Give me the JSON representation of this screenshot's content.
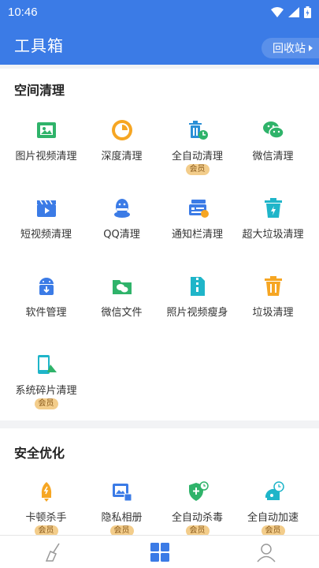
{
  "status": {
    "time": "10:46"
  },
  "app_bar": {
    "title": "工具箱",
    "recycle_label": "回收站"
  },
  "section_space": {
    "title": "空间清理",
    "items": [
      {
        "label": "图片视频清理",
        "icon": "picture-icon"
      },
      {
        "label": "深度清理",
        "icon": "pie-icon"
      },
      {
        "label": "全自动清理",
        "icon": "auto-trash-icon",
        "badge": "会员"
      },
      {
        "label": "微信清理",
        "icon": "wechat-icon"
      },
      {
        "label": "短视频清理",
        "icon": "clapper-icon"
      },
      {
        "label": "QQ清理",
        "icon": "qq-icon"
      },
      {
        "label": "通知栏清理",
        "icon": "notification-icon"
      },
      {
        "label": "超大垃圾清理",
        "icon": "big-trash-icon"
      },
      {
        "label": "软件管理",
        "icon": "android-icon"
      },
      {
        "label": "微信文件",
        "icon": "wechat-folder-icon"
      },
      {
        "label": "照片视频瘦身",
        "icon": "zip-icon"
      },
      {
        "label": "垃圾清理",
        "icon": "trash-icon"
      },
      {
        "label": "系统碎片清理",
        "icon": "phone-broom-icon",
        "badge": "会员"
      }
    ]
  },
  "section_security": {
    "title": "安全优化",
    "items": [
      {
        "label": "卡顿杀手",
        "icon": "rocket-icon",
        "badge": "会员"
      },
      {
        "label": "隐私相册",
        "icon": "private-album-icon",
        "badge": "会员"
      },
      {
        "label": "全自动杀毒",
        "icon": "shield-clock-icon",
        "badge": "会员"
      },
      {
        "label": "全自动加速",
        "icon": "speed-clock-icon",
        "badge": "会员"
      }
    ]
  },
  "colors": {
    "primary": "#3b7be6",
    "green": "#2fb36a",
    "orange": "#f6a623",
    "vip": "#f3cd8b"
  }
}
